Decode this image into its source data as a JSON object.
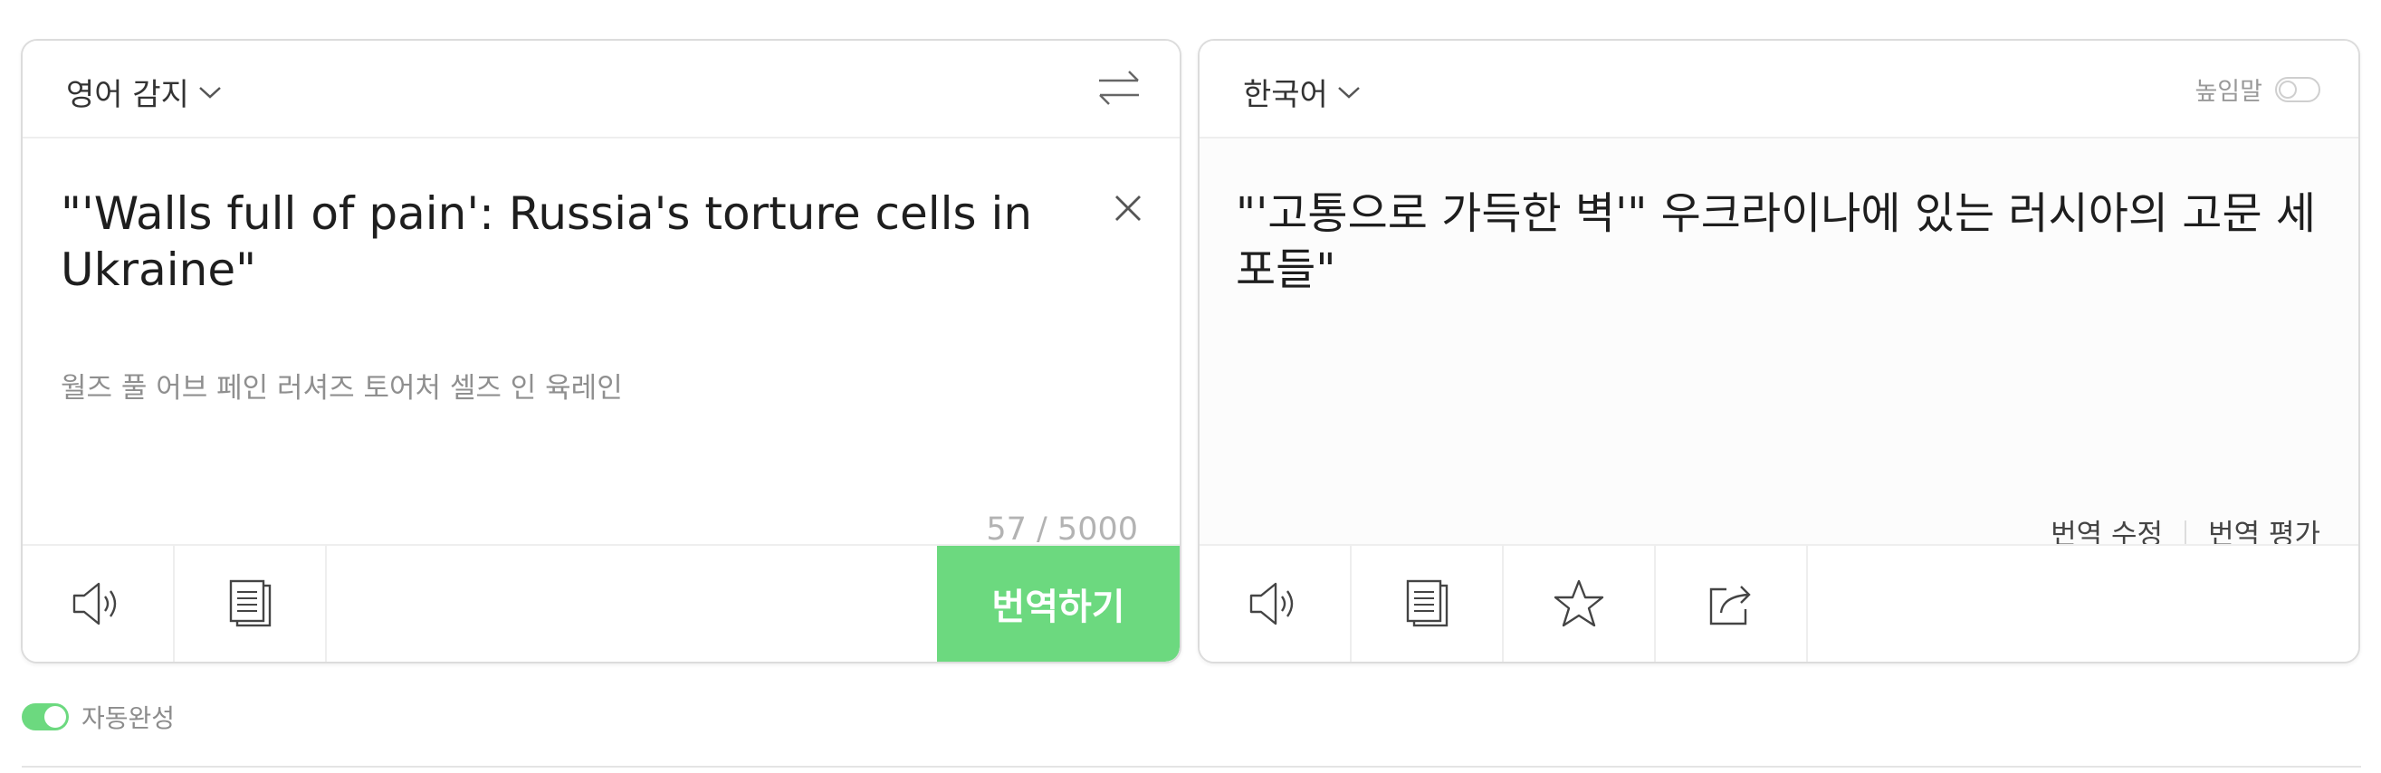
{
  "source": {
    "language_label": "영어 감지",
    "text": "\"'Walls full of pain': Russia's torture cells in Ukraine\"",
    "pronunciation": "월즈 풀 어브 페인 러셔즈 토어처 셀즈 인 육레인",
    "char_count": "57 / 5000",
    "translate_button": "번역하기"
  },
  "target": {
    "language_label": "한국어",
    "honorific_label": "높임말",
    "honorific_enabled": false,
    "text": "\"'고통으로 가득한 벽'\" 우크라이나에 있는 러시아의 고문 세포들\"",
    "edit_translation": "번역 수정",
    "rate_translation": "번역 평가"
  },
  "autocomplete": {
    "label": "자동완성",
    "enabled": true
  },
  "icons": {
    "source_tools": [
      "speaker-icon",
      "copy-icon"
    ],
    "target_tools": [
      "speaker-icon",
      "copy-icon",
      "star-icon",
      "share-icon"
    ],
    "header": [
      "chevron-down-icon",
      "swap-icon",
      "close-icon"
    ]
  },
  "colors": {
    "accent": "#6cd97f",
    "border": "#dcdcdc"
  }
}
